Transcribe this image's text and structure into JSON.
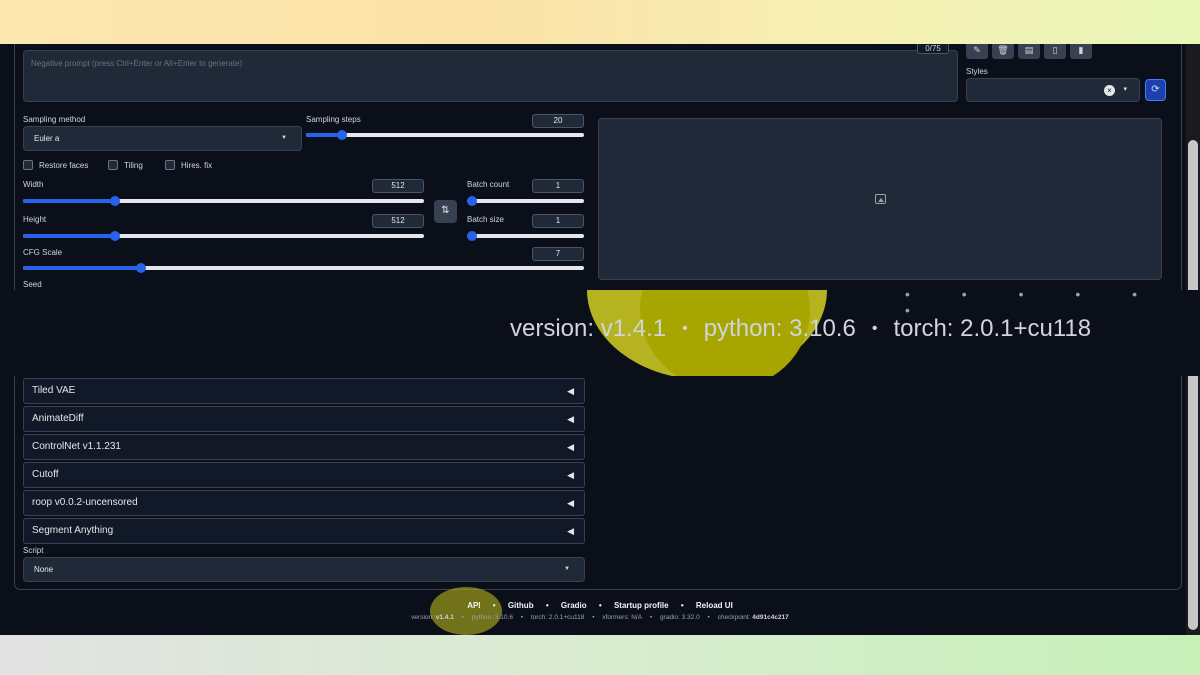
{
  "prompt": {
    "negative_placeholder": "Negative prompt (press Ctrl+Enter or Alt+Enter to generate)",
    "token_counter": "0/75"
  },
  "toolbar": {
    "icons": [
      "pencil-icon",
      "trash-icon",
      "paste-icon",
      "clipboard-icon",
      "clipboard-alt-icon"
    ]
  },
  "styles": {
    "label": "Styles",
    "clear": "×",
    "caret": "▾",
    "refresh": "⟳"
  },
  "sampling": {
    "method_label": "Sampling method",
    "method_value": "Euler a",
    "steps_label": "Sampling steps",
    "steps_value": "20",
    "steps_level": 0.13
  },
  "options": {
    "restore_faces": "Restore faces",
    "tiling": "Tiling",
    "hires_fix": "Hires. fix"
  },
  "size": {
    "width_label": "Width",
    "width_value": "512",
    "width_level": 0.23,
    "height_label": "Height",
    "height_value": "512",
    "height_level": 0.23,
    "swap": "⇅"
  },
  "batch": {
    "count_label": "Batch count",
    "count_value": "1",
    "size_label": "Batch size",
    "size_value": "1"
  },
  "cfg": {
    "label": "CFG Scale",
    "value": "7",
    "level": 0.21
  },
  "seed": {
    "label": "Seed"
  },
  "zoom": {
    "version": "version: v1.4.1",
    "python": "python: 3.10.6",
    "torch": "torch: 2.0.1+cu118",
    "sep": "•"
  },
  "accordions": [
    "Tiled VAE",
    "AnimateDiff",
    "ControlNet v1.1.231",
    "Cutoff",
    "roop v0.0.2-uncensored",
    "Segment Anything"
  ],
  "script": {
    "label": "Script",
    "value": "None"
  },
  "footer": {
    "links": [
      "API",
      "Github",
      "Gradio",
      "Startup profile",
      "Reload UI"
    ],
    "sep": "•",
    "info": {
      "version": "version: ",
      "version_val": "v1.4.1",
      "python": "python: 3.10.6",
      "torch": "torch: 2.0.1+cu118",
      "xformers": "xformers: N/A",
      "gradio": "gradio: 3.32.0",
      "checkpoint": "checkpoint: ",
      "checkpoint_val": "4d91c4c217"
    }
  }
}
